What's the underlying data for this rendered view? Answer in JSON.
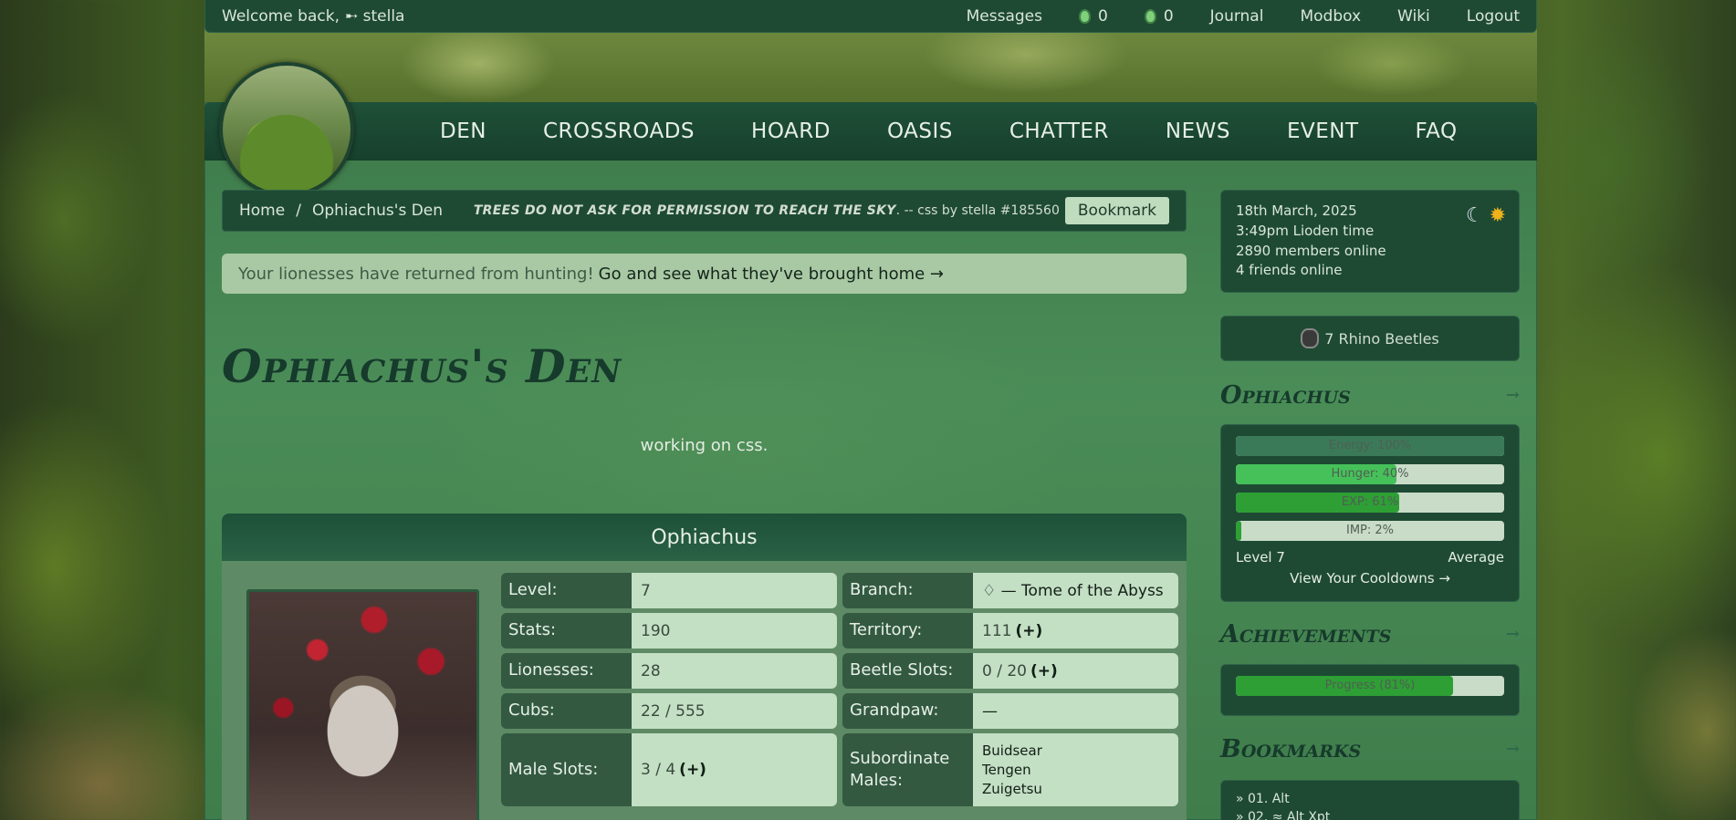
{
  "topbar": {
    "welcome": "Welcome back,",
    "username": "➸ stella",
    "links": [
      "Messages",
      "Journal",
      "Modbox",
      "Wiki",
      "Logout"
    ],
    "counter1": "0",
    "counter2": "0"
  },
  "nav": {
    "items": [
      "DEN",
      "CROSSROADS",
      "HOARD",
      "OASIS",
      "CHATTER",
      "NEWS",
      "EVENT",
      "FAQ"
    ]
  },
  "breadcrumb": {
    "home": "Home",
    "sep": "/",
    "current": "Ophiachus's Den",
    "quote": "TREES DO NOT ASK FOR PERMISSION TO REACH THE SKY",
    "credit": ". -- css by stella #185560",
    "bookmark": "Bookmark"
  },
  "alert": {
    "text": "Your lionesses have returned from hunting!",
    "link": "Go and see what they've brought home →"
  },
  "den": {
    "title": "Ophiachus's Den",
    "description": "working on css."
  },
  "profile": {
    "name": "Ophiachus",
    "rows": [
      {
        "label": "Level:",
        "value": "7"
      },
      {
        "label": "Branch:",
        "value": "♢ — Tome of the Abyss"
      },
      {
        "label": "Stats:",
        "value": "190"
      },
      {
        "label": "Territory:",
        "value": "111",
        "plus": "(+)"
      },
      {
        "label": "Lionesses:",
        "value": "28"
      },
      {
        "label": "Beetle Slots:",
        "value": "0 / 20",
        "plus": "(+)"
      },
      {
        "label": "Cubs:",
        "value": "22 / 555"
      },
      {
        "label": "Grandpaw:",
        "value": "—"
      },
      {
        "label": "Male Slots:",
        "value": "3 / 4",
        "plus": "(+)"
      },
      {
        "label": "Subordinate Males:",
        "names": [
          "Buidsear",
          "Tengen",
          "Zuigetsu"
        ]
      }
    ]
  },
  "sidebar": {
    "date": "18th March, 2025",
    "time": "3:49pm Lioden time",
    "members": "2890 members online",
    "friends": "4 friends online",
    "beetles": "7 Rhino Beetles",
    "lion_heading": "Ophiachus",
    "energy": {
      "label": "Energy: 100%",
      "value": 100
    },
    "hunger": {
      "label": "Hunger: 40%",
      "value": 60
    },
    "exp": {
      "label": "EXP: 61%",
      "value": 61
    },
    "imp": {
      "label": "IMP: 2%",
      "value": 2
    },
    "level": "Level 7",
    "average": "Average",
    "cooldowns": "View Your Cooldowns →",
    "achievements_heading": "Achievements",
    "progress": {
      "label": "Progress (81%)",
      "value": 81
    },
    "bookmarks_heading": "Bookmarks",
    "bookmarks": [
      "» 01. Alt",
      "» 02. ≈ Alt Xpt"
    ]
  },
  "colors": {
    "accent": "#1e4a34",
    "bar_green": "#2e9f35",
    "bar_light": "#46c15a"
  }
}
